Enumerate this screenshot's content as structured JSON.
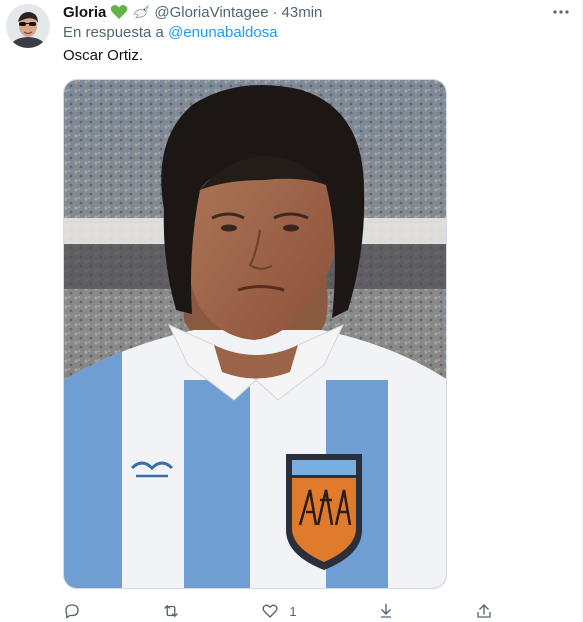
{
  "tweet": {
    "display_name": "Gloria",
    "emoji": [
      "green-heart-icon",
      "dove-icon"
    ],
    "handle": "@GloriaVintagee",
    "separator": "·",
    "time": "43min",
    "reply_prefix": "En respuesta a",
    "reply_to": "@enunabaldosa",
    "text": "Oscar Ortiz.",
    "image_icon": "football-player-photo",
    "actions": {
      "reply_icon": "reply-icon",
      "retweet_icon": "retweet-icon",
      "like_icon": "heart-outline-icon",
      "like_count": "1",
      "share_icon": "share-icon",
      "upload_icon": "upload-icon"
    }
  },
  "colors": {
    "text": "#0f1419",
    "secondary": "#536471",
    "link": "#1d9bf0",
    "heart": "#63b34a"
  }
}
